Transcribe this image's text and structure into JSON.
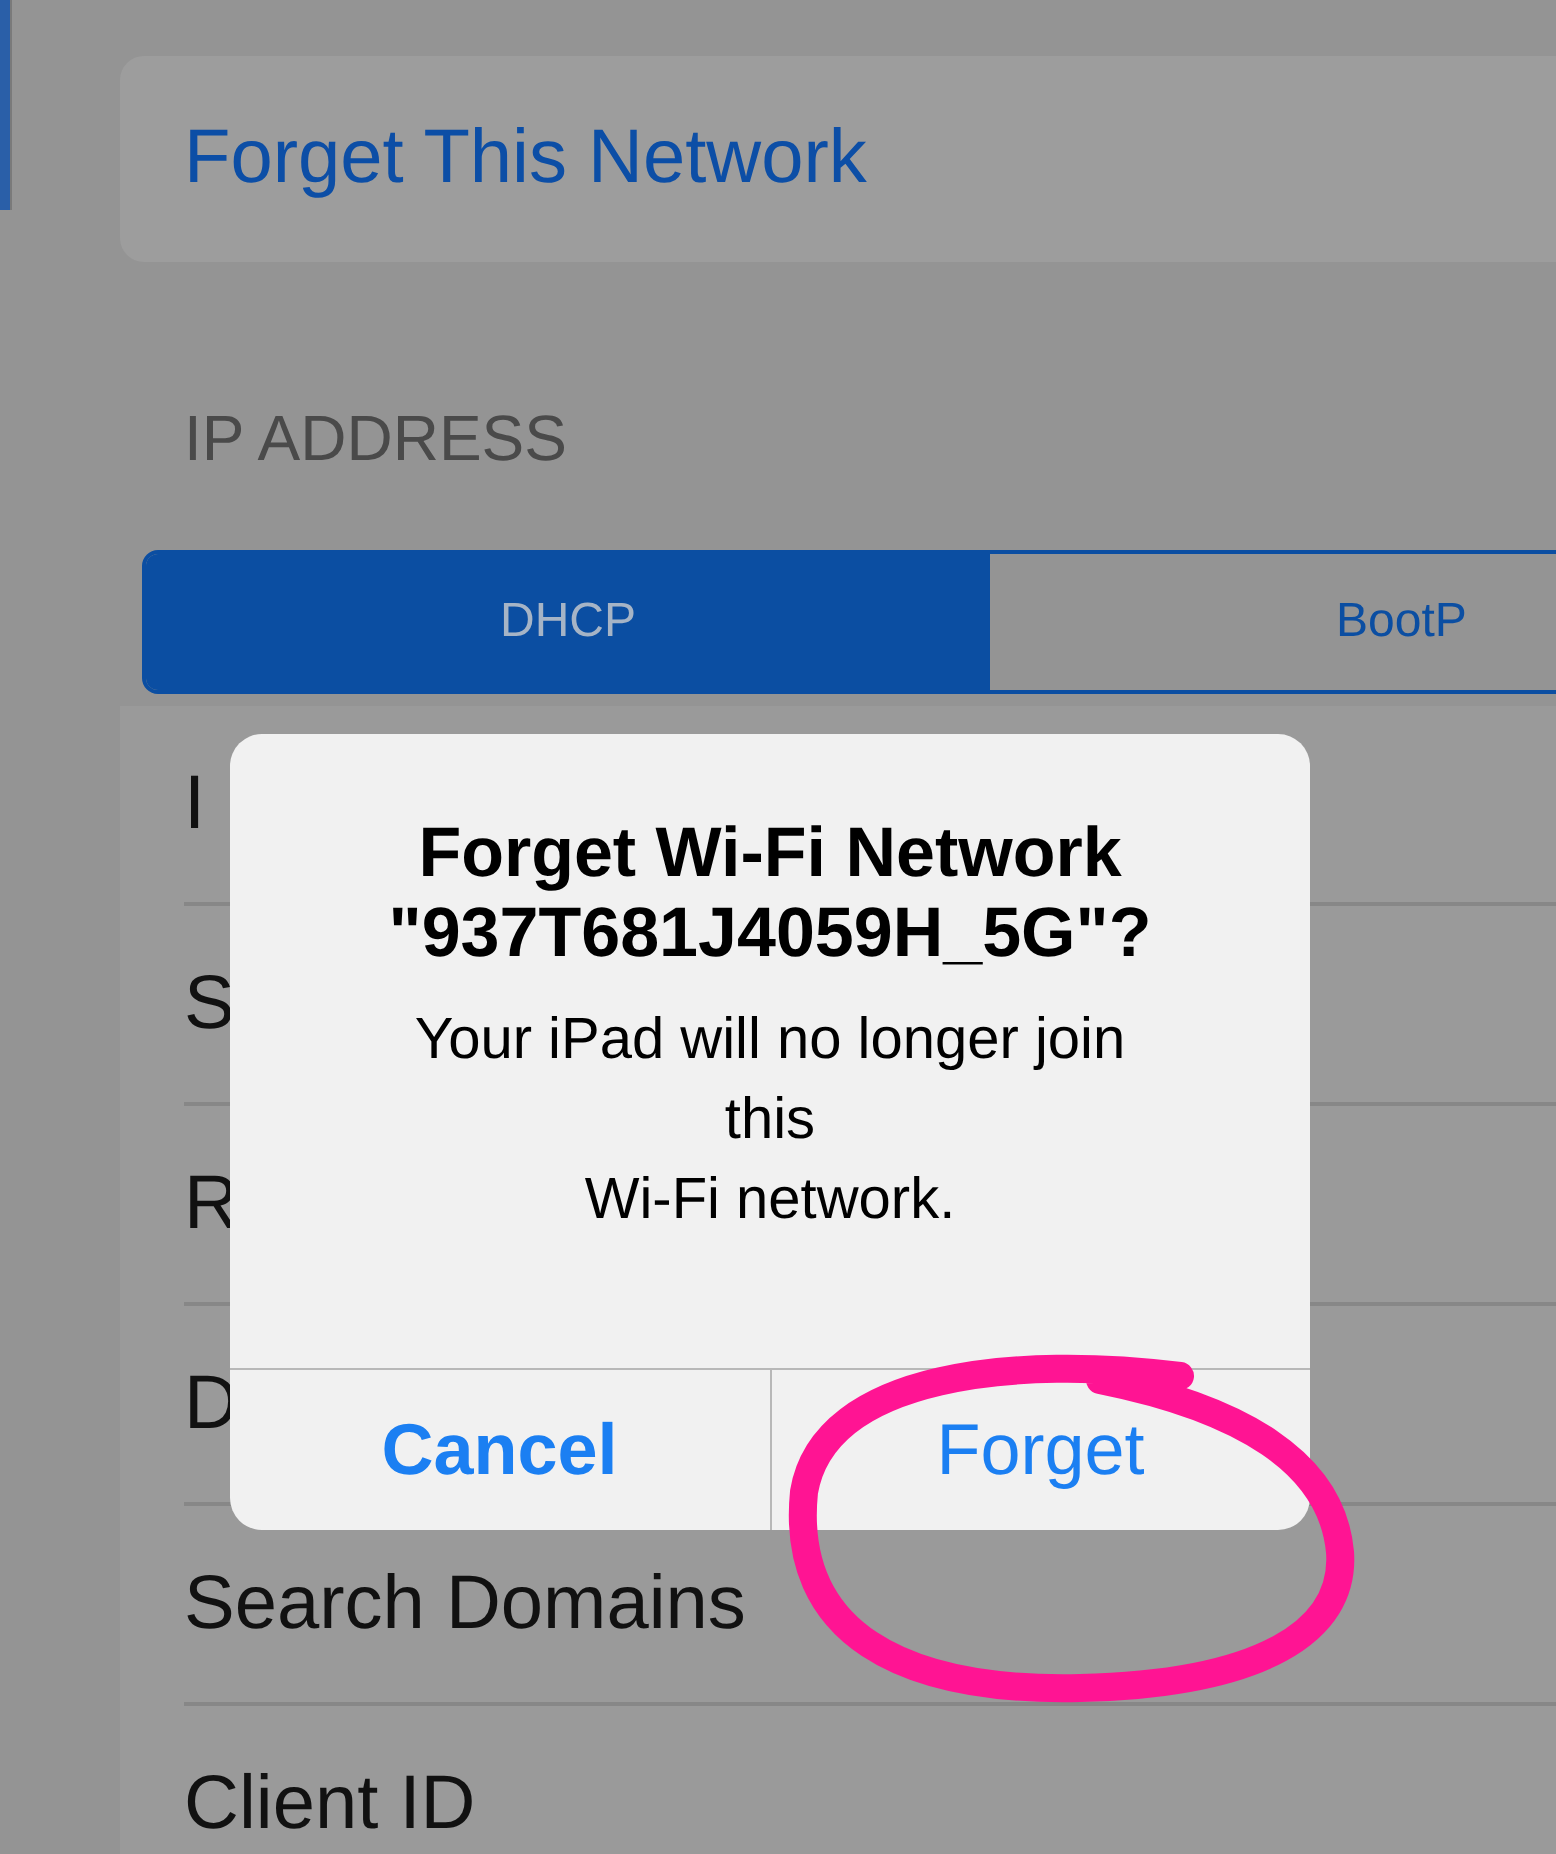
{
  "forget_button": "Forget This Network",
  "ip_address": {
    "header": "IP ADDRESS",
    "segments": [
      {
        "label": "DHCP",
        "selected": true
      },
      {
        "label": "BootP",
        "selected": false
      }
    ]
  },
  "rows": [
    "I",
    "S",
    "R",
    "D",
    "Search Domains",
    "Client ID"
  ],
  "alert": {
    "title": "Forget Wi-Fi Network \"937T681J4059H_5G\"?",
    "message": "Your iPad will no longer join\nthis\nWi-Fi network.",
    "buttons": [
      {
        "label": "Cancel",
        "kind": "cancel"
      },
      {
        "label": "Forget",
        "kind": "default"
      }
    ]
  },
  "annotation": {
    "kind": "circle",
    "color": "#ff1493"
  }
}
